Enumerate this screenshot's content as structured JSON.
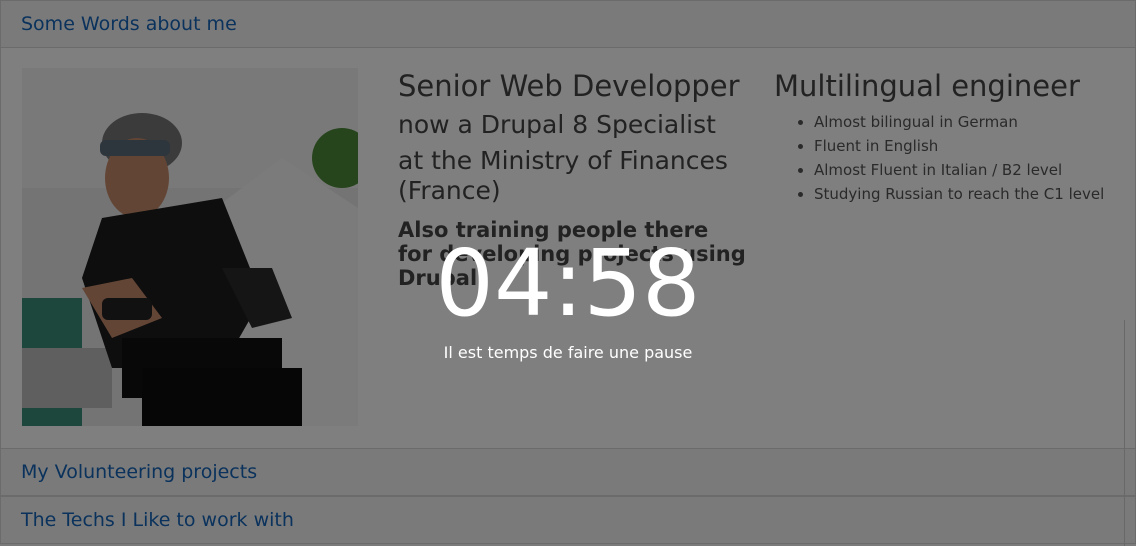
{
  "sections": {
    "about_title": "Some Words about me",
    "volunteering_title": "My Volunteering projects",
    "techs_title": "The Techs I Like to work with"
  },
  "about": {
    "role_line1": "Senior Web Developper",
    "role_line2": "now a Drupal 8 Specialist",
    "role_line3": "at the Ministry of Finances (France)",
    "role_line4": "Also training people there for developing projects using Drupal",
    "languages_title": "Multilingual engineer",
    "languages": [
      "Almost bilingual in German",
      "Fluent in English",
      "Almost Fluent in Italian / B2 level",
      "Studying Russian to reach the C1 level"
    ]
  },
  "pause": {
    "timer": "04:58",
    "message": "Il est temps de faire une pause"
  },
  "colors": {
    "link": "#1565b8",
    "overlay": "rgba(0,0,0,0.5)"
  }
}
